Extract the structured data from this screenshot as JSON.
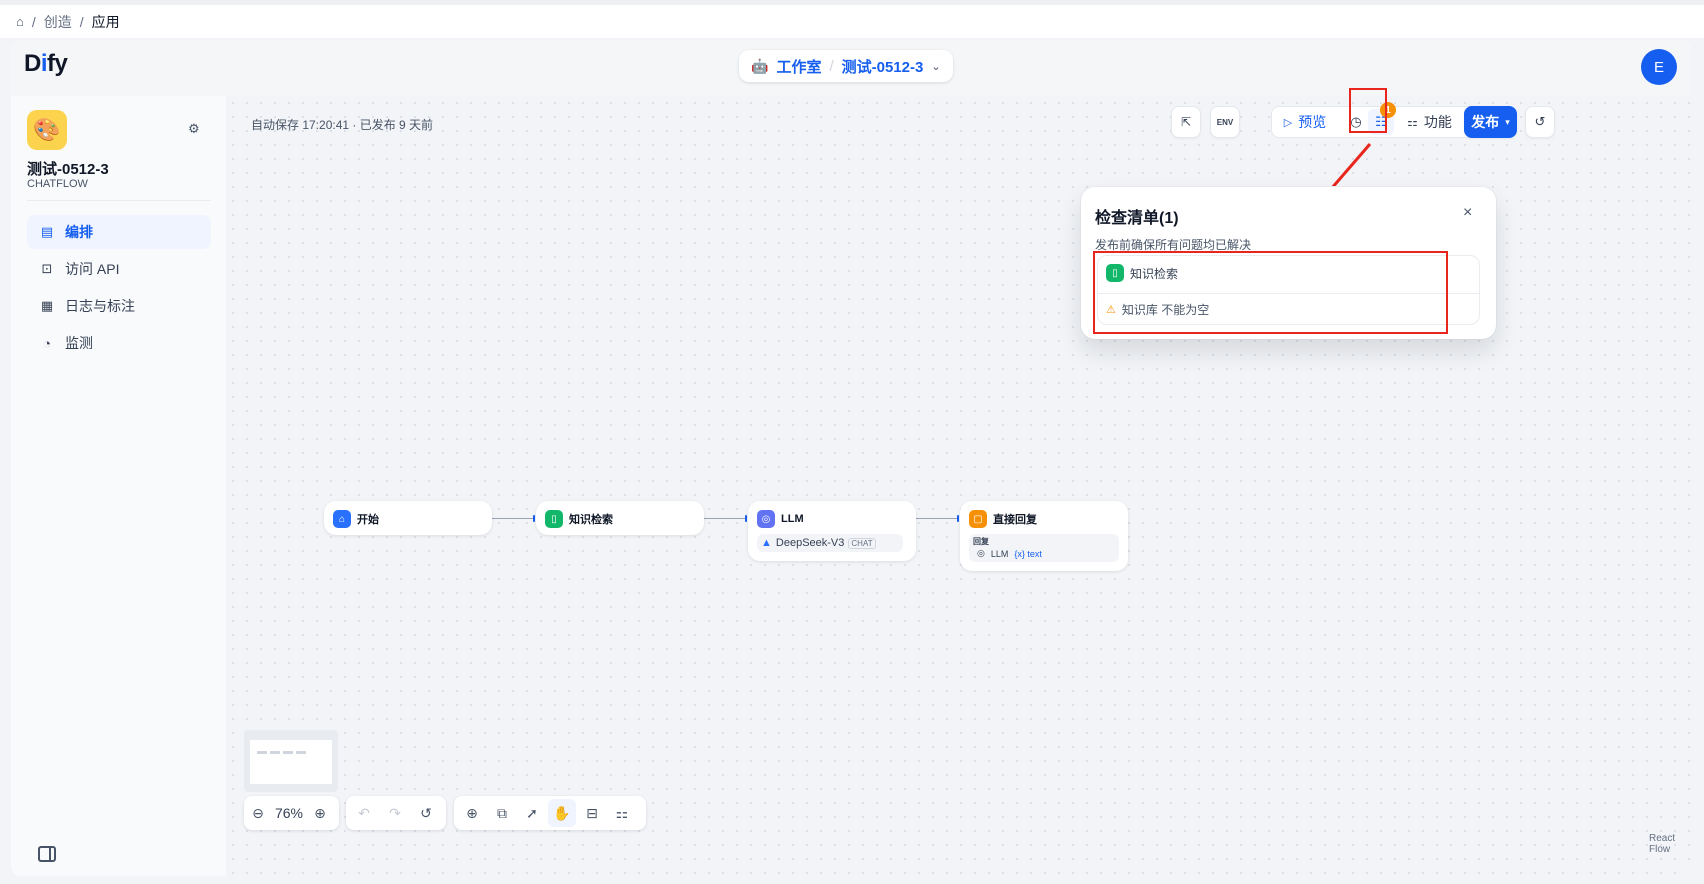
{
  "breadcrumb": {
    "home_icon": "home-icon",
    "sep": "/",
    "items": [
      "创造",
      "应用"
    ]
  },
  "header": {
    "logo": {
      "prefix": "D",
      "i": "i",
      "suffix": "fy"
    },
    "studio": "工作室",
    "slash": "/",
    "app": "测试-0512-3",
    "chevron": "⌄",
    "avatar": "E"
  },
  "sidebar": {
    "app_name": "测试-0512-3",
    "app_type": "CHATFLOW",
    "app_emoji": "🎨",
    "nav": [
      {
        "label": "编排",
        "icon": "layout-icon",
        "active": true
      },
      {
        "label": "访问 API",
        "icon": "terminal-icon",
        "active": false
      },
      {
        "label": "日志与标注",
        "icon": "file-list-icon",
        "active": false
      },
      {
        "label": "监测",
        "icon": "dashboard-icon",
        "active": false
      }
    ]
  },
  "toolbar": {
    "autosave": "自动保存 17:20:41 · 已发布 9 天前",
    "preview": "预览",
    "features": "功能",
    "publish": "发布",
    "env": "ENV",
    "checklist_badge": "1"
  },
  "checklist": {
    "title": "检查清单(1)",
    "subtitle": "发布前确保所有问题均已解决",
    "close": "×",
    "issue_node": "知识检索",
    "issue_message": "知识库 不能为空"
  },
  "nodes": [
    {
      "label": "开始",
      "type": "start"
    },
    {
      "label": "知识检索",
      "type": "knowledge-retrieval"
    },
    {
      "label": "LLM",
      "type": "llm",
      "model": "DeepSeek-V3",
      "mode": "CHAT"
    },
    {
      "label": "直接回复",
      "type": "answer",
      "field_label": "回复",
      "var_source": "LLM",
      "var_name": "{x} text"
    }
  ],
  "controls": {
    "zoom": "76%"
  },
  "attribution": "React Flow"
}
